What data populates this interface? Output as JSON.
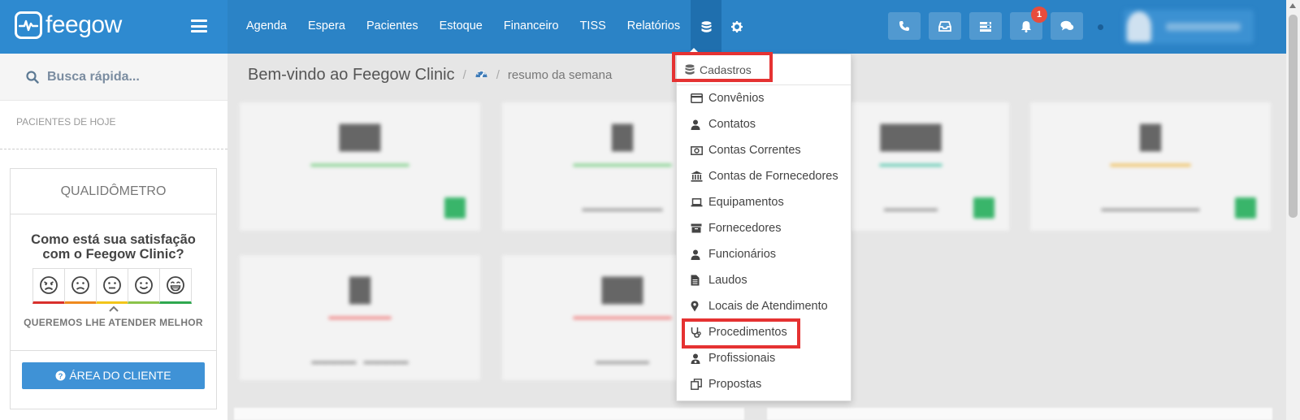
{
  "brand": {
    "name": "feegow"
  },
  "nav": {
    "items": [
      {
        "id": "agenda",
        "label": "Agenda"
      },
      {
        "id": "espera",
        "label": "Espera"
      },
      {
        "id": "pacientes",
        "label": "Pacientes"
      },
      {
        "id": "estoque",
        "label": "Estoque"
      },
      {
        "id": "financeiro",
        "label": "Financeiro"
      },
      {
        "id": "tiss",
        "label": "TISS"
      },
      {
        "id": "relatorios",
        "label": "Relatórios"
      }
    ],
    "icons": [
      "database-icon",
      "gear-icon"
    ]
  },
  "header_actions": {
    "icons": [
      "phone-icon",
      "inbox-icon",
      "queue-icon",
      "bell-icon",
      "chat-icon"
    ],
    "notification_count": "1"
  },
  "sidebar": {
    "search_label": "Busca rápida...",
    "today_label": "PACIENTES DE HOJE",
    "qualidometro": {
      "title": "QUALIDÔMETRO",
      "question_line1": "Como está sua satisfação",
      "question_line2": "com o Feegow Clinic?",
      "caption": "QUEREMOS LHE ATENDER MELHOR",
      "faces": [
        {
          "icon": "angry-face-icon",
          "color": "#d9302c"
        },
        {
          "icon": "frown-face-icon",
          "color": "#ef8a1f"
        },
        {
          "icon": "neutral-face-icon",
          "color": "#f2c51a"
        },
        {
          "icon": "smile-face-icon",
          "color": "#8bc34a"
        },
        {
          "icon": "grin-face-icon",
          "color": "#2fa84f"
        }
      ]
    },
    "client_button": "ÁREA DO CLIENTE"
  },
  "main": {
    "title": "Bem-vindo ao Feegow Clinic",
    "breadcrumb_sub": "resumo da semana"
  },
  "dropdown": {
    "header": "Cadastros",
    "items": [
      {
        "label": "Convênios",
        "icon": "credit-card-icon"
      },
      {
        "label": "Contatos",
        "icon": "user-icon"
      },
      {
        "label": "Contas Correntes",
        "icon": "money-icon"
      },
      {
        "label": "Contas de Fornecedores",
        "icon": "bank-icon"
      },
      {
        "label": "Equipamentos",
        "icon": "laptop-icon"
      },
      {
        "label": "Fornecedores",
        "icon": "archive-icon"
      },
      {
        "label": "Funcionários",
        "icon": "user-icon"
      },
      {
        "label": "Laudos",
        "icon": "file-icon"
      },
      {
        "label": "Locais de Atendimento",
        "icon": "map-marker-icon"
      },
      {
        "label": "Procedimentos",
        "icon": "stethoscope-icon"
      },
      {
        "label": "Profissionais",
        "icon": "user-md-icon"
      },
      {
        "label": "Propostas",
        "icon": "copy-icon"
      }
    ],
    "highlighted": [
      "Cadastros",
      "Procedimentos"
    ],
    "highlight_color": "#e53232"
  },
  "colors": {
    "topbar": "#2b83c6",
    "brand_bg": "#2e8ad0",
    "active_nav": "#1f6fae",
    "client_button": "#3f92d6"
  }
}
